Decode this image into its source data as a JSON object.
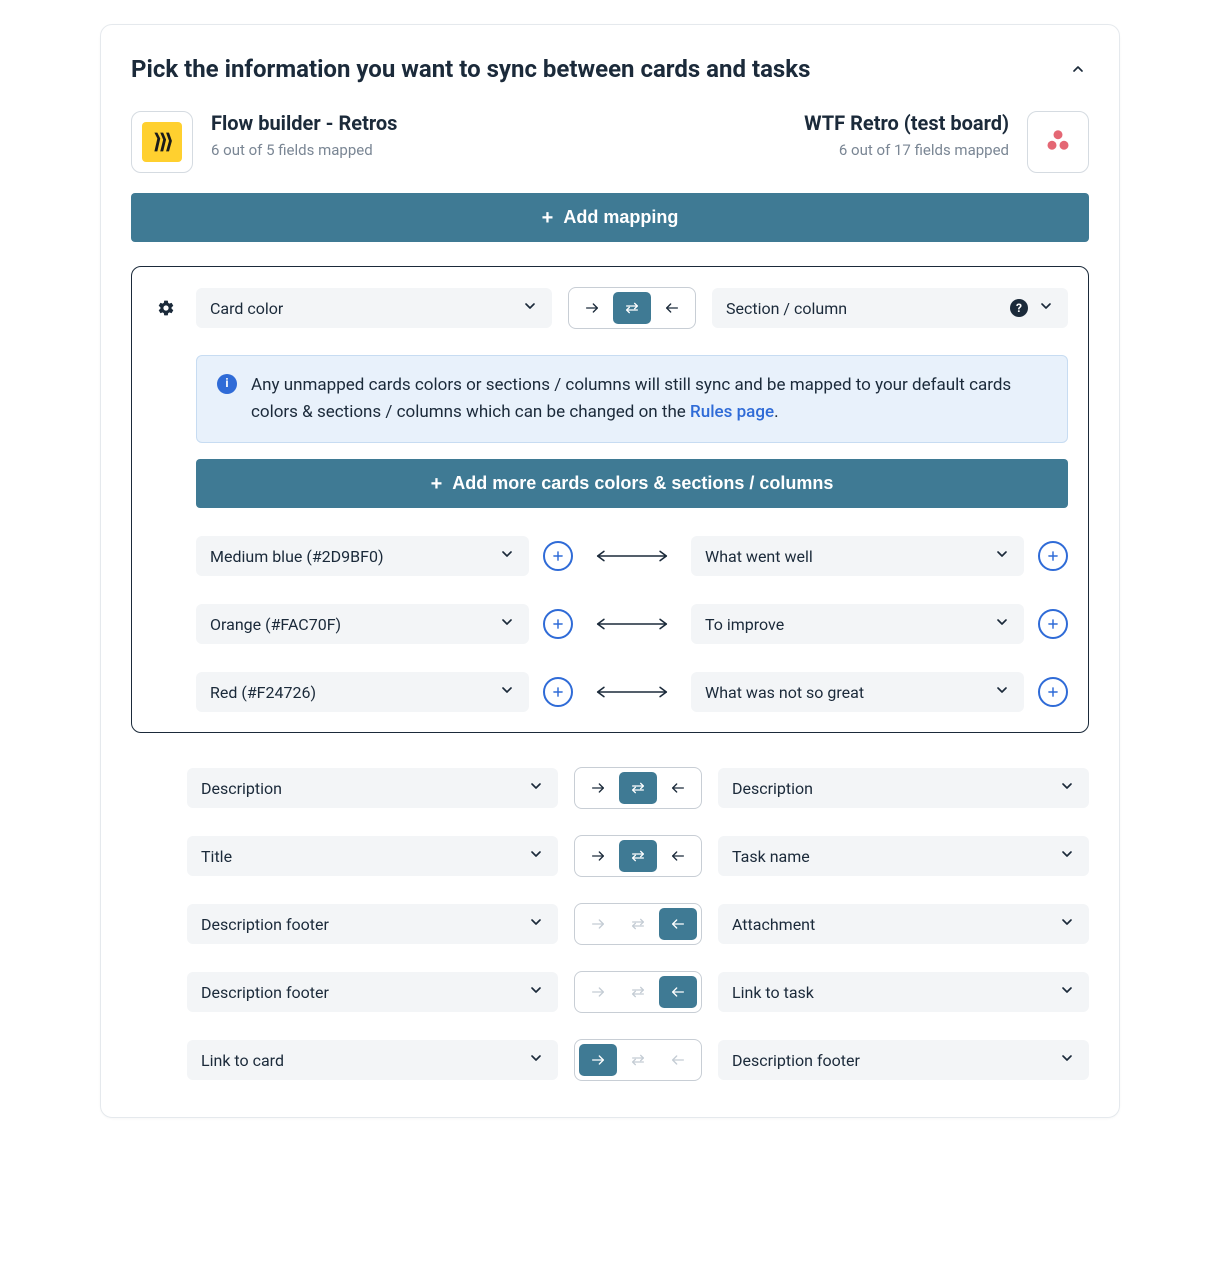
{
  "title": "Pick the information you want to sync between cards and tasks",
  "left_app": {
    "name": "Flow builder - Retros",
    "sub": "6 out of 5 fields mapped"
  },
  "right_app": {
    "name": "WTF Retro (test board)",
    "sub": "6 out of 17 fields mapped"
  },
  "add_mapping_label": "Add mapping",
  "panel": {
    "left_field": "Card color",
    "right_field": "Section / column",
    "info_text_pre": "Any unmapped cards colors or sections / columns will still sync and be mapped to your default cards colors & sections / columns which can be changed on the ",
    "info_link": "Rules page",
    "info_text_post": ".",
    "add_more_label": "Add more cards colors & sections / columns",
    "color_map": [
      {
        "left": "Medium blue (#2D9BF0)",
        "right": "What went well"
      },
      {
        "left": "Orange (#FAC70F)",
        "right": "To improve"
      },
      {
        "left": "Red (#F24726)",
        "right": "What was not so great"
      }
    ]
  },
  "rows": [
    {
      "left": "Description",
      "right": "Description",
      "direction": "both"
    },
    {
      "left": "Title",
      "right": "Task name",
      "direction": "both"
    },
    {
      "left": "Description footer",
      "right": "Attachment",
      "direction": "from-right"
    },
    {
      "left": "Description footer",
      "right": "Link to task",
      "direction": "from-right"
    },
    {
      "left": "Link to card",
      "right": "Description footer",
      "direction": "to-right"
    }
  ]
}
